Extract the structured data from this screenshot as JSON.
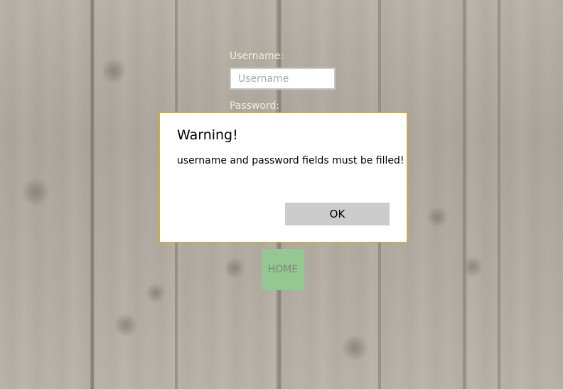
{
  "login": {
    "username_label": "Username:",
    "username_placeholder": "Username",
    "password_label": "Password:"
  },
  "home_button": {
    "label": "HOME",
    "color": "#94c792"
  },
  "dialog": {
    "title": "Warning!",
    "message": "username and password fields must be filled!",
    "ok_label": "OK",
    "border_color": "#e8b000"
  }
}
